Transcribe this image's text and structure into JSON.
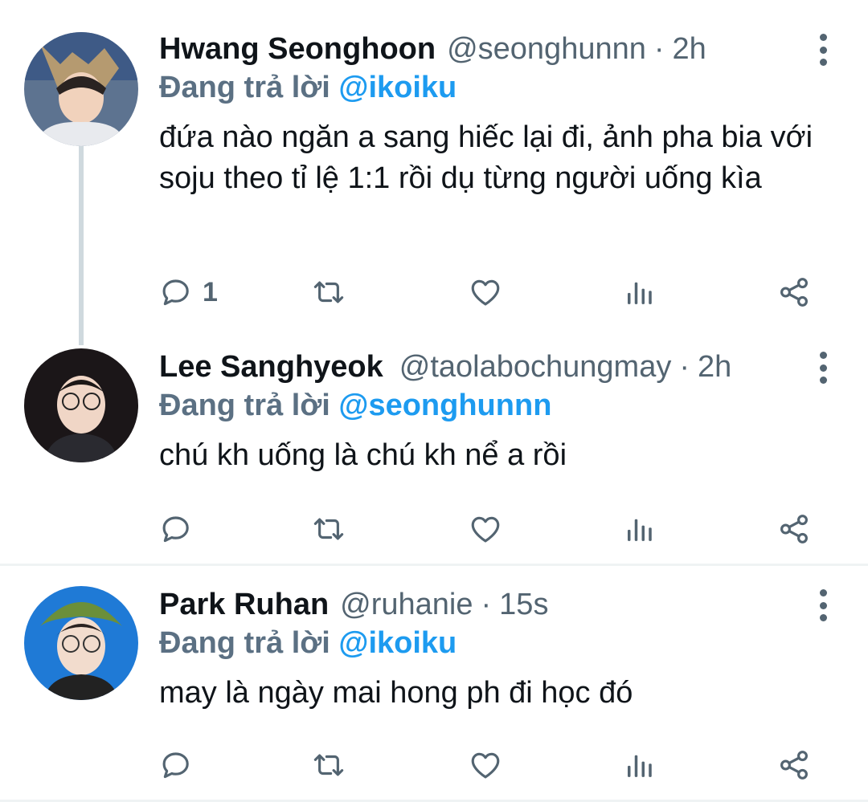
{
  "colors": {
    "accent": "#1d9bf0",
    "muted_text": "#536471",
    "reply_prefix": "#5b7083",
    "thread_line": "#cfd9de",
    "divider": "#eff3f4"
  },
  "tweets": [
    {
      "name": "Hwang Seonghoon",
      "handle": "@seonghunnn",
      "separator": "·",
      "time": "2h",
      "reply_prefix": "Đang trả lời",
      "reply_to": "@ikoiku",
      "text": "đứa nào ngăn a sang hiếc lại đi, ảnh pha bia với soju theo tỉ lệ 1:1 rồi dụ từng người uống kìa",
      "reply_count": "1",
      "icons": [
        "reply-icon",
        "retweet-icon",
        "like-icon",
        "views-icon",
        "share-icon",
        "more-icon"
      ]
    },
    {
      "name": "Lee Sanghyeok",
      "handle": "@taolabochungmay",
      "separator": "·",
      "time": "2h",
      "reply_prefix": "Đang trả lời",
      "reply_to": "@seonghunnn",
      "text": "chú kh uống là chú kh nể a rồi",
      "reply_count": "",
      "icons": [
        "reply-icon",
        "retweet-icon",
        "like-icon",
        "views-icon",
        "share-icon",
        "more-icon"
      ]
    },
    {
      "name": "Park Ruhan",
      "handle": "@ruhanie",
      "separator": "·",
      "time": "15s",
      "reply_prefix": "Đang trả lời",
      "reply_to": "@ikoiku",
      "text": "may là ngày mai hong ph đi học đó",
      "reply_count": "",
      "icons": [
        "reply-icon",
        "retweet-icon",
        "like-icon",
        "views-icon",
        "share-icon",
        "more-icon"
      ]
    }
  ]
}
